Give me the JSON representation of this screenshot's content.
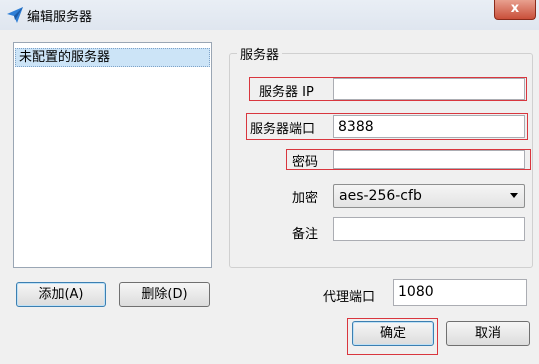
{
  "window": {
    "title": "编辑服务器",
    "close_glyph": "x"
  },
  "server_list": {
    "items": [
      "未配置的服务器"
    ]
  },
  "group": {
    "title": "服务器"
  },
  "form": {
    "server_ip": {
      "label": "服务器 IP",
      "value": ""
    },
    "server_port": {
      "label": "服务器端口",
      "value": "8388"
    },
    "password": {
      "label": "密码",
      "value": ""
    },
    "encryption": {
      "label": "加密",
      "value": "aes-256-cfb"
    },
    "remarks": {
      "label": "备注",
      "value": ""
    }
  },
  "proxy_port": {
    "label": "代理端口",
    "value": "1080"
  },
  "buttons": {
    "add": "添加(A)",
    "delete": "删除(D)",
    "ok": "确定",
    "cancel": "取消"
  },
  "colors": {
    "highlight_box": "#d9363e",
    "selection": "#cce4f7",
    "window_bg": "#f0f0f0"
  },
  "icons": {
    "app": "paper-plane-icon",
    "close": "close-icon"
  }
}
